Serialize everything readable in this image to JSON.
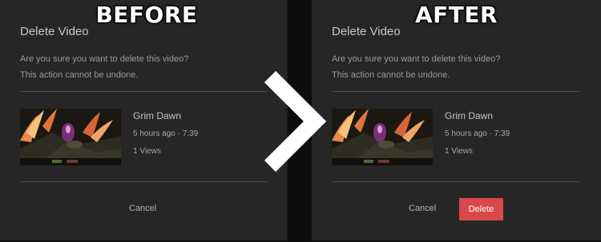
{
  "labels": {
    "before": "BEFORE",
    "after": "AFTER"
  },
  "dialog": {
    "title": "Delete Video",
    "message_line1": "Are you sure you want to delete this video?",
    "message_line2": "This action cannot be undone."
  },
  "video": {
    "title": "Grim Dawn",
    "meta": "5 hours ago · 7:39",
    "views": "1 Views"
  },
  "buttons": {
    "cancel": "Cancel",
    "delete": "Delete"
  },
  "colors": {
    "delete_button": "#d9484b",
    "panel_background": "#262626"
  },
  "icons": {
    "separator": "chevron-right-icon"
  }
}
